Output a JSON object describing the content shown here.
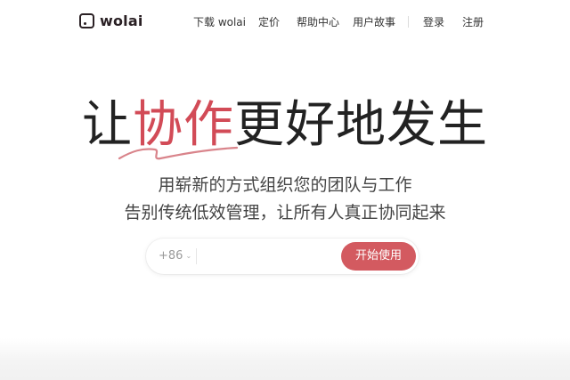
{
  "brand": {
    "name": "wolai"
  },
  "nav": {
    "download": "下载 wolai",
    "pricing": "定价",
    "help": "帮助中心",
    "stories": "用户故事",
    "login": "登录",
    "register": "注册"
  },
  "hero": {
    "headline_before": "让",
    "headline_accent": "协作",
    "headline_after": "更好地发生",
    "subtitle_line1": "用崭新的方式组织您的团队与工作",
    "subtitle_line2": "告别传统低效管理，让所有人真正协同起来"
  },
  "signup": {
    "country_code": "+86",
    "phone_value": "",
    "cta_label": "开始使用"
  },
  "colors": {
    "accent": "#d24b57",
    "button": "#d35a60",
    "brand_dark": "#2a2024"
  }
}
